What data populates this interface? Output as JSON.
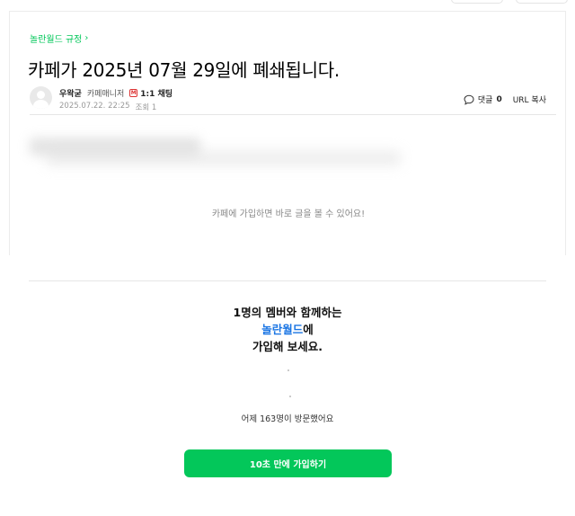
{
  "article": {
    "category": "놀란월드 규정",
    "title": "카페가 2025년 07월 29일에 폐쇄됩니다.",
    "author": {
      "name": "우왁굳",
      "role": "카페매니저",
      "chat_label": "1:1 채팅",
      "chat_badge": "M"
    },
    "date": "2025.07.22. 22:25",
    "views_label": "조회 1",
    "comment_label": "댓글",
    "comment_count": "0",
    "url_copy_label": "URL 복사",
    "locked_message": "카페에 가입하면 바로 글을 볼 수 있어요!"
  },
  "join": {
    "line1": "1명의 멤버와 함께하는",
    "cafe_name": "놀란월드",
    "line2_suffix": "에",
    "line3": "가입해 보세요.",
    "visitors": "어제 163명이 방문했어요",
    "button_label": "10초 만에 가입하기"
  },
  "colors": {
    "accent_green": "#03c75a",
    "cafe_blue": "#1b76e4"
  },
  "icons": {
    "comment": "speech-bubble-icon",
    "category_arrow": "chevron-right-icon",
    "avatar": "default-avatar-icon"
  }
}
